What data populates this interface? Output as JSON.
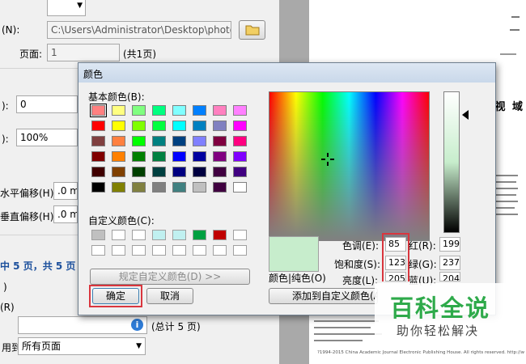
{
  "bg": {
    "n_label": "(N):",
    "path_value": "C:\\Users\\Administrator\\Desktop\\photo",
    "page_label": "页面:",
    "page_value": "1",
    "page_total": "(共1页)",
    "row1_value": "0",
    "row2_value": "100%",
    "h_offset_label": "水平偏移(H):",
    "h_offset_value": ".0 m",
    "v_offset_label": "垂直偏移(H):",
    "v_offset_value": ".0 m",
    "selected_pages": "中 5 页，共 5 页",
    "r_label": "(R)",
    "total_pages": "(总计 5 页)",
    "apply_label": "用到:",
    "apply_value": "所有页面"
  },
  "dialog": {
    "title": "颜色",
    "basic_colors_label": "基本颜色(B):",
    "custom_colors_label": "自定义颜色(C):",
    "define_custom_button": "规定自定义颜色(D) >>",
    "ok_button": "确定",
    "cancel_button": "取消",
    "color_solid_label": "颜色|纯色(O)",
    "hue_label": "色调(E):",
    "hue_value": "85",
    "sat_label": "饱和度(S):",
    "sat_value": "123",
    "lum_label": "亮度(L):",
    "lum_value": "205",
    "red_label": "红(R):",
    "red_value": "199",
    "green_label": "绿(G):",
    "green_value": "237",
    "blue_label": "蓝(U):",
    "blue_value": "204",
    "add_custom_button": "添加到自定义颜色(A)",
    "basic_colors": [
      [
        "#ff8080",
        "#ffff80",
        "#80ff80",
        "#00ff80",
        "#80ffff",
        "#0080ff",
        "#ff80c0",
        "#ff80ff"
      ],
      [
        "#ff0000",
        "#ffff00",
        "#80ff00",
        "#00ff40",
        "#00ffff",
        "#0080c0",
        "#8080c0",
        "#ff00ff"
      ],
      [
        "#804040",
        "#ff8040",
        "#00ff00",
        "#008080",
        "#004080",
        "#8080ff",
        "#800040",
        "#ff0080"
      ],
      [
        "#800000",
        "#ff8000",
        "#008000",
        "#008040",
        "#0000ff",
        "#0000a0",
        "#800080",
        "#8000ff"
      ],
      [
        "#400000",
        "#804000",
        "#004000",
        "#004040",
        "#000080",
        "#000040",
        "#400040",
        "#400080"
      ],
      [
        "#000000",
        "#808000",
        "#808040",
        "#808080",
        "#408080",
        "#c0c0c0",
        "#400040",
        "#ffffff"
      ]
    ],
    "custom_colors": [
      [
        "#c0c0c0",
        "#ffffff",
        "#ffffff",
        "#c0f0f0",
        "#c0f0f0",
        "#00a040",
        "#c00000",
        "#ffffff"
      ],
      [
        "#ffffff",
        "#ffffff",
        "#ffffff",
        "#ffffff",
        "#ffffff",
        "#ffffff",
        "#ffffff",
        "#ffffff"
      ]
    ],
    "preview_color": "#c7edcc"
  },
  "document": {
    "heading": "新 视 域",
    "footer": "?1994-2015 China Academic Journal Electronic Publishing House. All rights reserved.   http://w"
  },
  "watermark": {
    "title": "百科全说",
    "subtitle": "助你轻松解决"
  }
}
